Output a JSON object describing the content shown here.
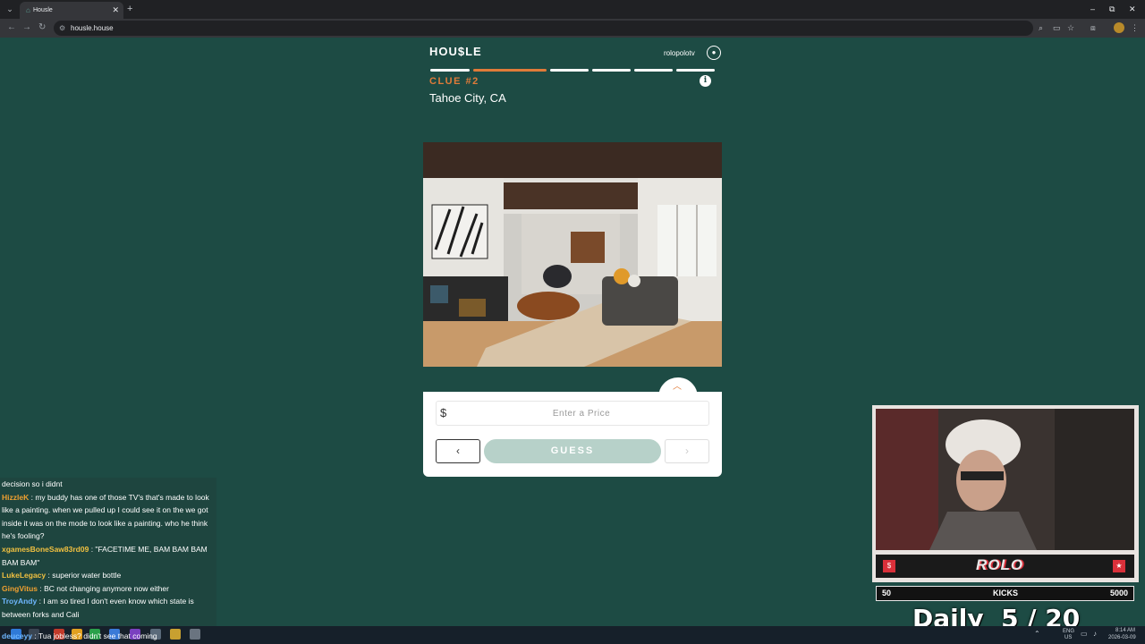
{
  "browser": {
    "tab_title": "Housle",
    "url": "housle.house",
    "tab_close": "✕",
    "new_tab": "+",
    "minimize": "–",
    "maximize": "⧉",
    "close": "✕"
  },
  "app": {
    "logo": "HOU$LE",
    "username": "rolopolotv",
    "clue_label": "CLUE #2",
    "location": "Tahoe City, CA",
    "progress": {
      "total": 6,
      "current": 2
    },
    "accent_color": "#e07b39",
    "background_color": "#1d4b44"
  },
  "guess": {
    "currency": "$",
    "placeholder": "Enter a Price",
    "value": "",
    "prev_label": "‹",
    "guess_label": "GUESS",
    "next_label": "›"
  },
  "chat": {
    "messages": [
      {
        "user": "",
        "user_color": "#ffffff",
        "text": "decision so i didnt"
      },
      {
        "user": "HizzleK",
        "user_color": "#f0a030",
        "text": "my buddy has one of those TV's that's made to look like a painting. when we pulled up I could see it on the we got inside it was on the mode to look like a painting. who he think he's fooling?"
      },
      {
        "user": "xgamesBoneSaw83rd09",
        "user_color": "#f0c040",
        "text": "\"FACETIME ME, BAM BAM BAM BAM BAM\""
      },
      {
        "user": "LukeLegacy",
        "user_color": "#f0c040",
        "text": "superior water bottle"
      },
      {
        "user": "GingVitus",
        "user_color": "#f0a030",
        "text": "BC not changing anymore now either"
      },
      {
        "user": "TroyAndy",
        "user_color": "#6fb7ff",
        "text": "I am so tired I don't even know which state is between forks and Cali"
      },
      {
        "user": "deuceyy",
        "user_color": "#6fb7ff",
        "text": "Tua jobless? didn't see that coming"
      }
    ]
  },
  "stream": {
    "cam_logo": "ROLO",
    "kicks_left": "50",
    "kicks_label": "KICKS",
    "kicks_right": "5000",
    "daily": "Daily  5 / 20"
  },
  "taskbar": {
    "time": "8:14 AM",
    "date": "2026-03-09",
    "lang_top": "ENG",
    "lang_bottom": "US"
  }
}
